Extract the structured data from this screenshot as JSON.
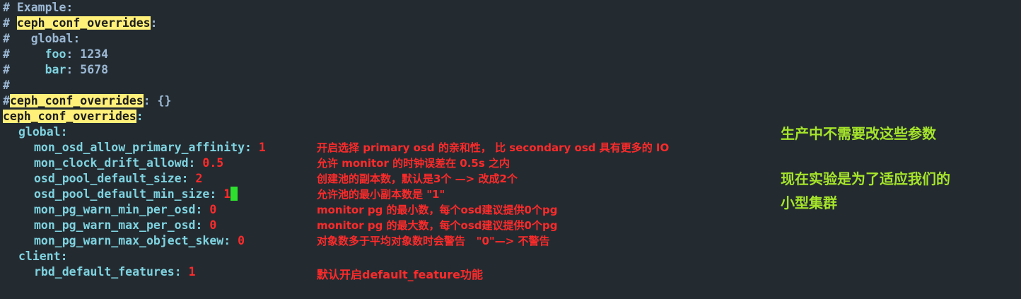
{
  "example_comment": {
    "hash": "#",
    "example": "# Example:",
    "key": "ceph_conf_overrides",
    "colon": ":",
    "global": "#   global:",
    "foo_prefix": "#     ",
    "foo_key": "foo",
    "foo_val": ": 1234",
    "bar_prefix": "#     ",
    "bar_key": "bar",
    "bar_val": ": 5678",
    "blank": "#"
  },
  "commented_default": {
    "hash": "#",
    "key": "ceph_conf_overrides",
    "rest": ": {}"
  },
  "active": {
    "key": "ceph_conf_overrides",
    "colon": ":",
    "global_label": "global:",
    "params": [
      {
        "key": "mon_osd_allow_primary_affinity",
        "value": "1",
        "note": "开启选择 primary osd 的亲和性， 比 secondary osd 具有更多的 IO"
      },
      {
        "key": "mon_clock_drift_allowd",
        "value": "0.5",
        "note": "允许 monitor 的时钟误差在 0.5s 之内"
      },
      {
        "key": "osd_pool_default_size",
        "value": "2",
        "note": "创建池的副本数，默认是3个 —> 改成2个"
      },
      {
        "key": "osd_pool_default_min_size",
        "value": "1",
        "note": "允许池的最小副本数是 \"1\""
      },
      {
        "key": "mon_pg_warn_min_per_osd",
        "value": "0",
        "note": "monitor pg 的最小数，每个osd建议提供0个pg"
      },
      {
        "key": "mon_pg_warn_max_per_osd",
        "value": "0",
        "note": "monitor pg 的最大数，每个osd建议提供0个pg"
      },
      {
        "key": "mon_pg_warn_max_object_skew",
        "value": "0",
        "note": "对象数多于平均对象数时会警告   \"0\"—> 不警告"
      }
    ],
    "client_label": "client:",
    "client_param": {
      "key": "rbd_default_features",
      "value": "1",
      "note": "默认开启default_feature功能"
    }
  },
  "side_notes": {
    "line1": "生产中不需要改这些参数",
    "line2": "现在实验是为了适应我们的",
    "line3": "小型集群"
  },
  "colors": {
    "background": "#232b31",
    "highlight": "#fff07a",
    "key": "#7fd3e0",
    "number": "#ff2a2a",
    "comment": "#9cb8d4",
    "annotation": "#ff2a2a",
    "side_note": "#a6e52a",
    "cursor": "#2ee02e"
  }
}
